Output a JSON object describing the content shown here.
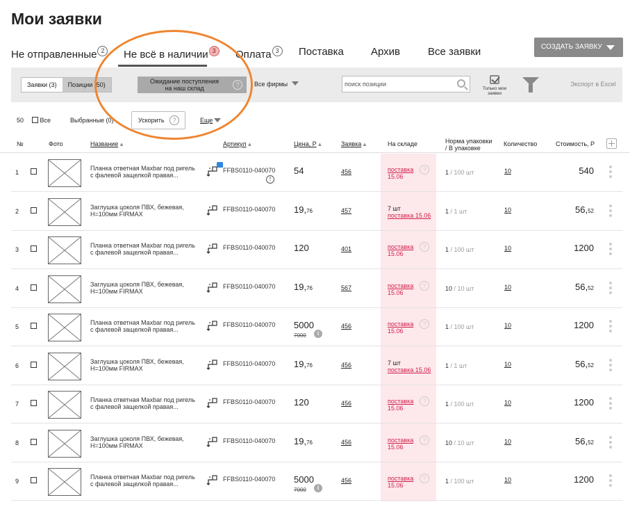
{
  "page_title": "Мои заявки",
  "tabs": [
    {
      "label": "Не отправленные",
      "badge": "2",
      "active": false
    },
    {
      "label": "Не всё в наличии",
      "badge": "3",
      "active": true
    },
    {
      "label": "Оплата",
      "badge": "3",
      "active": false
    },
    {
      "label": "Поставка",
      "badge": "",
      "active": false
    },
    {
      "label": "Архив",
      "badge": "",
      "active": false
    },
    {
      "label": "Все заявки",
      "badge": "",
      "active": false
    }
  ],
  "create_button": "СОЗДАТЬ ЗАЯВКУ",
  "toolbar": {
    "seg_orders": "Заявки (3)",
    "seg_positions": "Позиции (50)",
    "await_line1": "Ожидание поступления",
    "await_line2": "на наш склад",
    "firms": "Все фирмы",
    "search_placeholder": "поиск позиции",
    "only_mine_line1": "Только мои",
    "only_mine_line2": "заявки",
    "export": "Экспорт в Excel"
  },
  "controls": {
    "count": "50",
    "all": "Все",
    "selected": "Выбранные (0)",
    "speed_up": "Ускорить",
    "more": "Еще"
  },
  "columns": {
    "num": "№",
    "photo": "Фото",
    "name": "Название",
    "article": "Артикул",
    "price": "Цена, Р",
    "order": "Заявка",
    "stock": "На складе",
    "pack_line1": "Норма упаковки",
    "pack_line2": "/ В упаковке",
    "qty": "Количество",
    "cost": "Стоимость, Р"
  },
  "rows": [
    {
      "num": "1",
      "name1": "Планка ответная Maxbar под ригель",
      "name2": "с фалевой защелкой правая...",
      "art": "FFBS0110-040070",
      "price_int": "54",
      "price_dec": "",
      "old_price": "",
      "order": "456",
      "stock_qty": "",
      "stock_link1": "поставка",
      "stock_link2": "15.06",
      "pack_a": "1",
      "pack_b": "/ 100 шт",
      "qty": "10",
      "cost_int": "540",
      "cost_dec": "",
      "chat": true,
      "excl": true
    },
    {
      "num": "2",
      "name1": "Заглушка цоколя ПВХ, бежевая,",
      "name2": "H=100мм FIRMAX",
      "art": "FFBS0110-040070",
      "price_int": "19,",
      "price_dec": "76",
      "old_price": "",
      "order": "457",
      "stock_qty": "7 шт",
      "stock_link1": "поставка 15.06",
      "stock_link2": "",
      "pack_a": "1",
      "pack_b": "/ 1 шт",
      "qty": "10",
      "cost_int": "56,",
      "cost_dec": "52",
      "chat": false,
      "excl": false
    },
    {
      "num": "3",
      "name1": "Планка ответная Maxbar под ригель",
      "name2": "с фалевой защелкой правая...",
      "art": "FFBS0110-040070",
      "price_int": "120",
      "price_dec": "",
      "old_price": "",
      "order": "401",
      "stock_qty": "",
      "stock_link1": "поставка",
      "stock_link2": "15.06",
      "pack_a": "1",
      "pack_b": "/ 100 шт",
      "qty": "10",
      "cost_int": "1200",
      "cost_dec": "",
      "chat": false,
      "excl": false
    },
    {
      "num": "4",
      "name1": "Заглушка цоколя ПВХ, бежевая,",
      "name2": "H=100мм FIRMAX",
      "art": "FFBS0110-040070",
      "price_int": "19,",
      "price_dec": "76",
      "old_price": "",
      "order": "567",
      "stock_qty": "",
      "stock_link1": "поставка",
      "stock_link2": "15.06",
      "pack_a": "10",
      "pack_b": "/ 10 шт",
      "qty": "10",
      "cost_int": "56,",
      "cost_dec": "52",
      "chat": false,
      "excl": false
    },
    {
      "num": "5",
      "name1": "Планка ответная Maxbar под ригель",
      "name2": "с фалевой защелкой правая...",
      "art": "FFBS0110-040070",
      "price_int": "5000",
      "price_dec": "",
      "old_price": "7000",
      "order": "456",
      "stock_qty": "",
      "stock_link1": "поставка",
      "stock_link2": "15.06",
      "pack_a": "1",
      "pack_b": "/ 100 шт",
      "qty": "10",
      "cost_int": "1200",
      "cost_dec": "",
      "chat": false,
      "excl": false
    },
    {
      "num": "6",
      "name1": "Заглушка цоколя ПВХ, бежевая,",
      "name2": "H=100мм FIRMAX",
      "art": "FFBS0110-040070",
      "price_int": "19,",
      "price_dec": "76",
      "old_price": "",
      "order": "456",
      "stock_qty": "7 шт",
      "stock_link1": "поставка 15.06",
      "stock_link2": "",
      "pack_a": "1",
      "pack_b": "/ 1 шт",
      "qty": "10",
      "cost_int": "56,",
      "cost_dec": "52",
      "chat": false,
      "excl": false
    },
    {
      "num": "7",
      "name1": "Планка ответная Maxbar под ригель",
      "name2": "с фалевой защелкой правая...",
      "art": "FFBS0110-040070",
      "price_int": "120",
      "price_dec": "",
      "old_price": "",
      "order": "456",
      "stock_qty": "",
      "stock_link1": "поставка",
      "stock_link2": "15.06",
      "pack_a": "1",
      "pack_b": "/ 100 шт",
      "qty": "10",
      "cost_int": "1200",
      "cost_dec": "",
      "chat": false,
      "excl": false
    },
    {
      "num": "8",
      "name1": "Заглушка цоколя ПВХ, бежевая,",
      "name2": "H=100мм FIRMAX",
      "art": "FFBS0110-040070",
      "price_int": "19,",
      "price_dec": "76",
      "old_price": "",
      "order": "456",
      "stock_qty": "",
      "stock_link1": "поставка",
      "stock_link2": "15.06",
      "pack_a": "10",
      "pack_b": "/ 10 шт",
      "qty": "10",
      "cost_int": "56,",
      "cost_dec": "52",
      "chat": false,
      "excl": false
    },
    {
      "num": "9",
      "name1": "Планка ответная Maxbar под ригель",
      "name2": "с фалевой защелкой правая...",
      "art": "FFBS0110-040070",
      "price_int": "5000",
      "price_dec": "",
      "old_price": "7000",
      "order": "456",
      "stock_qty": "",
      "stock_link1": "поставка",
      "stock_link2": "15.06",
      "pack_a": "1",
      "pack_b": "/ 100 шт",
      "qty": "10",
      "cost_int": "1200",
      "cost_dec": "",
      "chat": false,
      "excl": false
    }
  ],
  "colors": {
    "accent_orange": "#ef8530",
    "stock_band": "#fde8ec",
    "stock_red": "#d0204a",
    "create_btn": "#8a8a8a"
  }
}
